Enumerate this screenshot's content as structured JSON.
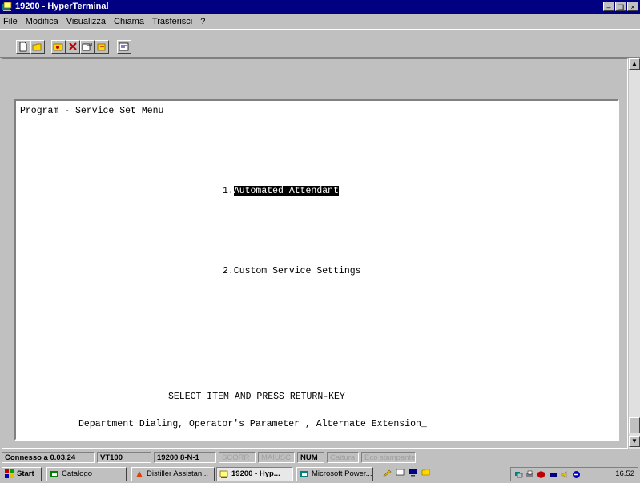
{
  "window": {
    "title": "19200 - HyperTerminal",
    "controls": [
      "minimize",
      "maximize",
      "close"
    ]
  },
  "menu": [
    "File",
    "Modifica",
    "Visualizza",
    "Chiama",
    "Trasferisci",
    "?"
  ],
  "toolbar": {
    "buttons": [
      "new-icon",
      "open-icon",
      "connect-icon",
      "disconnect-icon",
      "send-icon",
      "receive-icon",
      "properties-icon"
    ]
  },
  "terminal": {
    "header": "Program - Service Set Menu",
    "item1_number": "1.",
    "item1_label": "Automated Attendant",
    "item2": "2.Custom Service Settings",
    "prompt": "SELECT ITEM AND PRESS RETURN-KEY",
    "footer": "Department Dialing, Operator's Parameter , Alternate Extension",
    "cursor": "_"
  },
  "status": {
    "connected": "Connesso a 0.03.24",
    "emulation": "VT100",
    "port": "19200 8-N-1",
    "scroll": "SCORR",
    "caps": "MAIUSC",
    "num": "NUM",
    "capture": "Cattura",
    "echo": "Eco stampante"
  },
  "taskbar": {
    "start": "Start",
    "tasks": [
      "Catalogo",
      "Distiller Assistan...",
      "19200 - Hyp...",
      "Microsoft Power..."
    ],
    "clock": "16.52"
  },
  "colors": {
    "titlebar": "#000080",
    "face": "#c0c0c0",
    "terminal_bg": "#ffffff",
    "highlight": "#000000"
  }
}
